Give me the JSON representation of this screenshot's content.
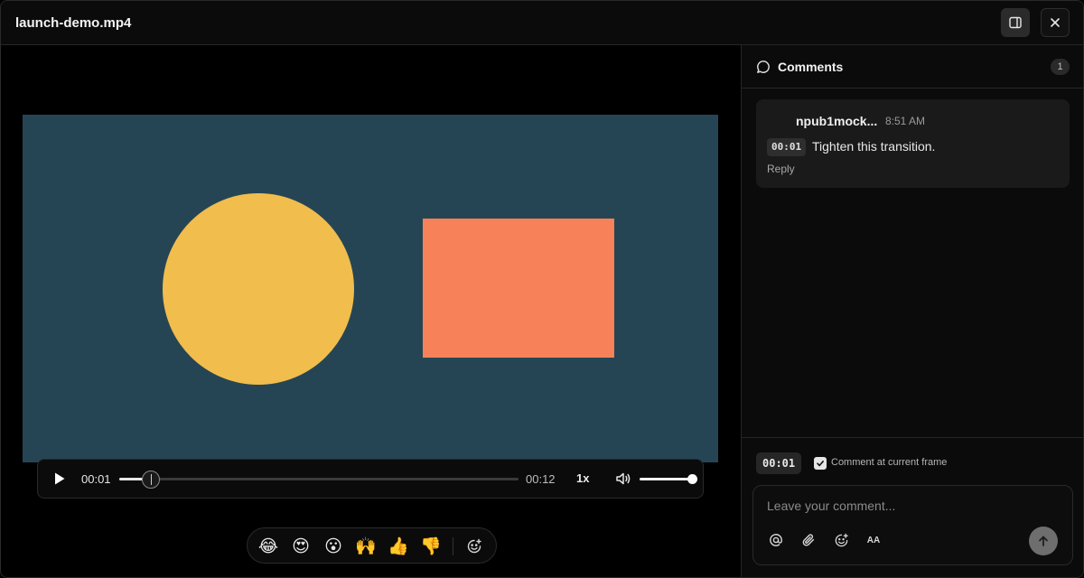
{
  "window": {
    "title": "launch-demo.mp4"
  },
  "toolbar": {
    "panel_icon": "side-panel-icon",
    "close_icon": "close-icon"
  },
  "video": {
    "background": "#264554",
    "circle_color": "#f1bd4d",
    "rect_color": "#f7825a"
  },
  "player": {
    "current_time": "00:01",
    "duration": "00:12",
    "progress": 0.08,
    "rate": "1x",
    "volume": 1.0
  },
  "reactions": {
    "emojis": [
      "😂",
      "😍",
      "😮",
      "🙌",
      "👍",
      "👎"
    ],
    "add_icon": "emoji-add-icon"
  },
  "comments": {
    "title": "Comments",
    "count": "1",
    "items": [
      {
        "author": "npub1mock...",
        "time": "8:51 AM",
        "timestamp": "00:01",
        "text": "Tighten this transition.",
        "reply_label": "Reply"
      }
    ]
  },
  "composer": {
    "frame_time": "00:01",
    "frame_checkbox_label": "Comment at current frame",
    "frame_checked": true,
    "placeholder": "Leave your comment...",
    "format_label": "AA"
  }
}
